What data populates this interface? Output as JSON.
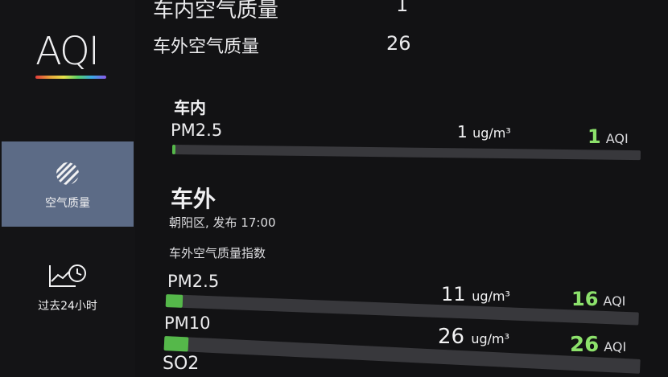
{
  "logo": "AQI",
  "nav": [
    {
      "label": "空气质量",
      "icon": "air-quality-icon",
      "active": true
    },
    {
      "label": "过去24小时",
      "icon": "history-chart-icon",
      "active": false
    }
  ],
  "summary": {
    "inside_label": "车内空气质量",
    "inside_value": "1",
    "outside_label": "车外空气质量",
    "outside_value": "26"
  },
  "inside": {
    "title": "车内",
    "pm25": {
      "name": "PM2.5",
      "amount": "1",
      "unit": "ug/m³",
      "aqi": "1",
      "aqi_unit": "AQI",
      "level": 0.004
    }
  },
  "outside": {
    "title": "车外",
    "subtitle": "朝阳区, 发布 17:00",
    "index_label": "车外空气质量指数",
    "items": [
      {
        "name": "PM2.5",
        "amount": "11",
        "unit": "ug/m³",
        "aqi": "16",
        "aqi_unit": "AQI",
        "level": 0.035
      },
      {
        "name": "PM10",
        "amount": "26",
        "unit": "ug/m³",
        "aqi": "26",
        "aqi_unit": "AQI",
        "level": 0.05
      },
      {
        "name": "SO2"
      }
    ]
  },
  "colors": {
    "good": "#8ce16b",
    "bar": "#55b84a",
    "track": "#38383c",
    "active_nav": "#5c6b86"
  }
}
